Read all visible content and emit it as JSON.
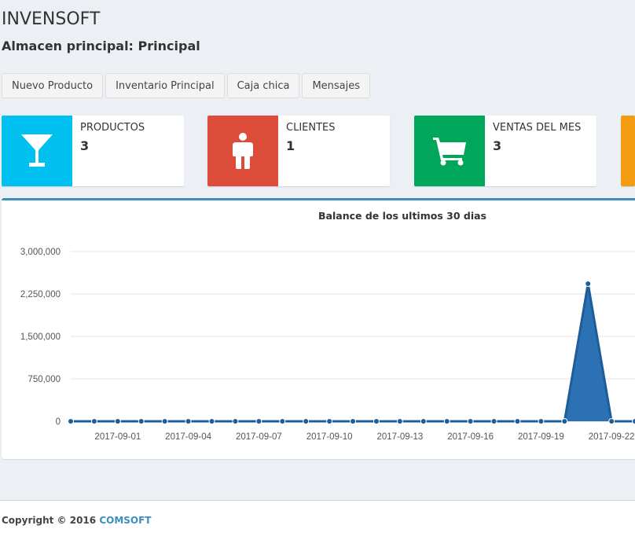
{
  "header": {
    "title": "INVENSOFT",
    "subtitle": "Almacen principal: Principal"
  },
  "buttons": [
    {
      "label": "Nuevo Producto"
    },
    {
      "label": "Inventario Principal"
    },
    {
      "label": "Caja chica"
    },
    {
      "label": "Mensajes"
    }
  ],
  "info_boxes": [
    {
      "label": "PRODUCTOS",
      "number": "3",
      "color": "#00c0ef",
      "icon": "cocktail-glass-icon"
    },
    {
      "label": "CLIENTES",
      "number": "1",
      "color": "#dd4b39",
      "icon": "person-icon"
    },
    {
      "label": "VENTAS DEL MES",
      "number": "3",
      "color": "#00a65a",
      "icon": "shopping-cart-icon"
    },
    {
      "color": "#f39c12"
    }
  ],
  "chart_data": {
    "type": "area",
    "title": "Balance de los ultimos 30 dias",
    "x": [
      "2017-08-30",
      "2017-08-31",
      "2017-09-01",
      "2017-09-02",
      "2017-09-03",
      "2017-09-04",
      "2017-09-05",
      "2017-09-06",
      "2017-09-07",
      "2017-09-08",
      "2017-09-09",
      "2017-09-10",
      "2017-09-11",
      "2017-09-12",
      "2017-09-13",
      "2017-09-14",
      "2017-09-15",
      "2017-09-16",
      "2017-09-17",
      "2017-09-18",
      "2017-09-19",
      "2017-09-20",
      "2017-09-21",
      "2017-09-22",
      "2017-09-23"
    ],
    "values": [
      0,
      0,
      0,
      0,
      0,
      0,
      0,
      0,
      0,
      0,
      0,
      0,
      0,
      0,
      0,
      0,
      0,
      0,
      0,
      0,
      0,
      0,
      2430000,
      0,
      0
    ],
    "x_tick_labels": [
      "2017-09-01",
      "2017-09-04",
      "2017-09-07",
      "2017-09-10",
      "2017-09-13",
      "2017-09-16",
      "2017-09-19",
      "2017-09-22"
    ],
    "y_tick_labels": [
      "3,000,000",
      "2,250,000",
      "1,500,000",
      "750,000",
      "0"
    ],
    "y_ticks": [
      3000000,
      2250000,
      1500000,
      750000,
      0
    ],
    "ylim": [
      0,
      3000000
    ],
    "grid": true,
    "color": "#2c71b3"
  },
  "footer": {
    "text": "Copyright © 2016",
    "link": "COMSOFT"
  }
}
